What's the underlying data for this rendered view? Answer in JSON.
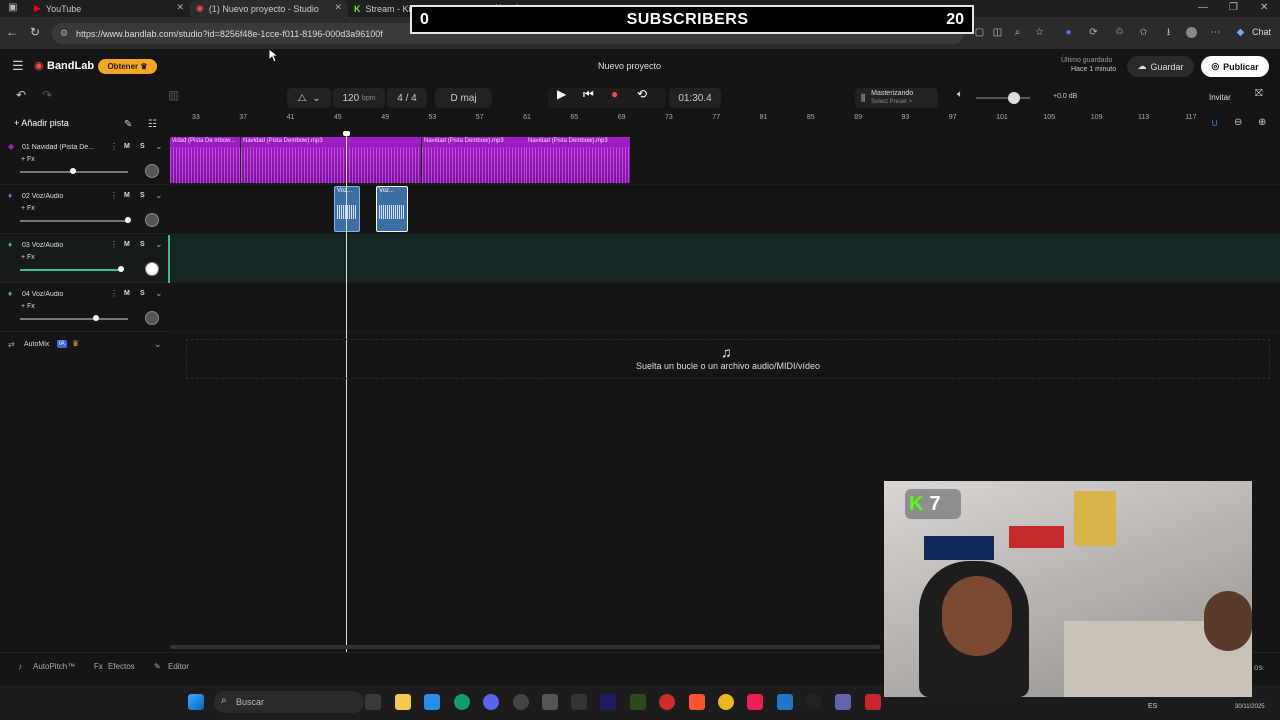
{
  "browser": {
    "tabs": [
      {
        "label": "YouTube"
      },
      {
        "label": "(1) Nuevo proyecto - Studio"
      },
      {
        "label": "Stream - Kick Dashboard"
      }
    ],
    "url": "https://www.bandlab.com/studio?id=8256f48e-1cce-f011-8196-000d3a96100f",
    "chat_label": "Chat"
  },
  "overlay": {
    "left_count": "0",
    "title": "SUBSCRIBERS",
    "right_count": "20"
  },
  "app": {
    "logo": "BandLab",
    "obtener": "Obtener",
    "project_title": "Nuevo proyecto",
    "last_saved_label": "Último guardado",
    "last_saved_value": "Hace 1 minuto",
    "guardar": "Guardar",
    "publicar": "Publicar",
    "invitar": "Invitar",
    "tempo": "120",
    "tempo_unit": "bpm",
    "time_sig": "4 / 4",
    "key": "D maj",
    "time": "01:30.4",
    "mastering_label": "Masterizando",
    "mastering_preset": "Select Preset >",
    "volume_db": "+0.0 dB",
    "add_track": "Añadir pista",
    "ruler": [
      "33",
      "37",
      "41",
      "45",
      "49",
      "53",
      "57",
      "61",
      "65",
      "69",
      "73",
      "77",
      "81",
      "85",
      "89",
      "93",
      "97",
      "101",
      "105",
      "109",
      "113",
      "117"
    ],
    "tracks": [
      {
        "name": "01  Navidad (Pista De...",
        "fx": "+ Fx"
      },
      {
        "name": "02  Voz/Audio",
        "fx": "+ Fx"
      },
      {
        "name": "03  Voz/Audio",
        "fx": "+ Fx"
      },
      {
        "name": "04  Voz/Audio",
        "fx": "+ Fx"
      }
    ],
    "mute": "M",
    "solo": "S",
    "clips": [
      "vidad (Pista De mbow...",
      "Navidad (Pista Dembow).mp3",
      "Navidad (Pista Dembow).mp3",
      "Navidad (Pista Dembow).mp3"
    ],
    "voice_clips": [
      "Voz...",
      "Voz..."
    ],
    "automix": "AutoMix",
    "ia_badge": "IA",
    "drop_hint": "Suelta un bucle o un archivo audio/MIDI/vídeo",
    "bottom": [
      "AutoPitch™",
      "Efectos",
      "Editor"
    ],
    "bottom_right": "os"
  },
  "taskbar": {
    "search": "Buscar",
    "lang": "ES",
    "date": "30/11/2025"
  },
  "webcam": {
    "kick_count": "7"
  },
  "colors": {
    "accent": "#f24c4c",
    "clip": "#a21ec8",
    "kick": "#53fc18"
  }
}
